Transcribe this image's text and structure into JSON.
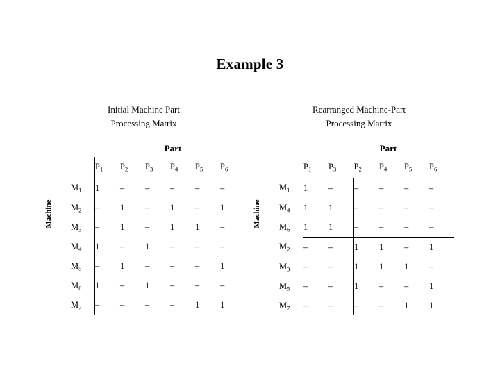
{
  "slide": {
    "title": "Example 3"
  },
  "left_panel": {
    "heading_line1": "Initial Machine Part",
    "heading_line2": "Processing Matrix",
    "axis_machine": "Machine",
    "axis_part": "Part",
    "column_headers": [
      "P1",
      "P2",
      "P3",
      "P4",
      "P5",
      "P6"
    ],
    "row_headers": [
      "M1",
      "M2",
      "M3",
      "M4",
      "M5",
      "M6",
      "M7"
    ],
    "rows": [
      [
        "1",
        "–",
        "–",
        "–",
        "–",
        "–"
      ],
      [
        "–",
        "1",
        "–",
        "1",
        "–",
        "1"
      ],
      [
        "–",
        "1",
        "–",
        "1",
        "1",
        "–"
      ],
      [
        "1",
        "–",
        "1",
        "–",
        "–",
        "–"
      ],
      [
        "–",
        "1",
        "–",
        "–",
        "–",
        "1"
      ],
      [
        "1",
        "–",
        "1",
        "–",
        "–",
        "–"
      ],
      [
        "–",
        "–",
        "–",
        "–",
        "1",
        "1"
      ]
    ]
  },
  "right_panel": {
    "heading_line1": "Rearranged Machine-Part",
    "heading_line2": "Processing Matrix",
    "axis_machine": "Machine",
    "axis_part": "Part",
    "column_headers": [
      "P1",
      "P3",
      "P2",
      "P4",
      "P5",
      "P6"
    ],
    "row_headers": [
      "M1",
      "M4",
      "M6",
      "M2",
      "M3",
      "M5",
      "M7"
    ],
    "rows": [
      [
        "1",
        "–",
        "–",
        "–",
        "–",
        "–"
      ],
      [
        "1",
        "1",
        "–",
        "–",
        "–",
        "–"
      ],
      [
        "1",
        "1",
        "–",
        "–",
        "–",
        "–"
      ],
      [
        "–",
        "–",
        "1",
        "1",
        "–",
        "1"
      ],
      [
        "–",
        "–",
        "1",
        "1",
        "1",
        "–"
      ],
      [
        "–",
        "–",
        "1",
        "–",
        "–",
        "1"
      ],
      [
        "–",
        "–",
        "–",
        "–",
        "1",
        "1"
      ]
    ],
    "block_divider_after_column": 2,
    "block_divider_after_row": 3
  },
  "colors": {
    "background": "#ffffff",
    "text": "#000000",
    "rule": "#000000"
  }
}
